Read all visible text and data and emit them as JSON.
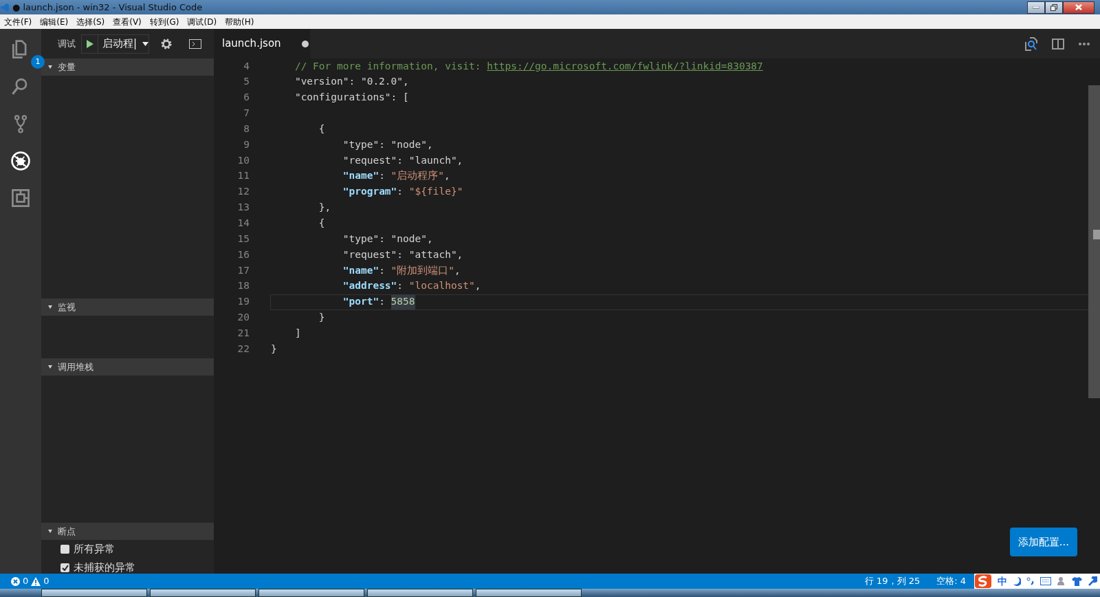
{
  "window": {
    "title": "● launch.json - win32 - Visual Studio Code"
  },
  "menu": [
    "文件(F)",
    "编辑(E)",
    "选择(S)",
    "查看(V)",
    "转到(G)",
    "调试(D)",
    "帮助(H)"
  ],
  "activity_bar": [
    {
      "kind": "files",
      "badge": "1",
      "selected": false
    },
    {
      "kind": "search",
      "selected": false
    },
    {
      "kind": "git",
      "selected": false
    },
    {
      "kind": "debug",
      "selected": true
    },
    {
      "kind": "extensions",
      "selected": false
    }
  ],
  "debug_toolbar": {
    "label": "调试",
    "configuration": "启动程|"
  },
  "tab": {
    "label": "launch.json",
    "dirty": true
  },
  "sidebar": {
    "sections": [
      {
        "title": "变量",
        "expanded": true
      },
      {
        "title": "监视",
        "expanded": true
      },
      {
        "title": "调用堆栈",
        "expanded": true
      },
      {
        "title": "断点",
        "expanded": true,
        "items": [
          {
            "label": "所有异常",
            "checked": false
          },
          {
            "label": "未捕获的异常",
            "checked": true
          }
        ]
      }
    ]
  },
  "editor": {
    "lines": [
      {
        "number": "4",
        "current": false,
        "kind": "i1",
        "tokens": [
          {
            "kind": "comment",
            "text": "// For more information, visit: "
          },
          {
            "kind": "link",
            "text": "https://go.microsoft.com/fwlink/?linkid=830387"
          }
        ]
      },
      {
        "number": "5",
        "current": false,
        "kind": "i1",
        "tokens": [
          {
            "kind": "plain",
            "text": "\"version\": \"0.2.0\","
          }
        ]
      },
      {
        "number": "6",
        "current": false,
        "kind": "i1",
        "tokens": [
          {
            "kind": "plain",
            "text": "\"configurations\": ["
          }
        ]
      },
      {
        "number": "7",
        "current": false,
        "kind": "i0"
      },
      {
        "number": "8",
        "current": false,
        "kind": "i2",
        "tokens": [
          {
            "kind": "plain",
            "text": "{"
          }
        ]
      },
      {
        "number": "9",
        "current": false,
        "kind": "i3",
        "tokens": [
          {
            "kind": "plain",
            "text": "\"type\": \"node\","
          }
        ]
      },
      {
        "number": "10",
        "current": false,
        "kind": "i3",
        "tokens": [
          {
            "kind": "plain",
            "text": "\"request\": \"launch\","
          }
        ]
      },
      {
        "number": "11",
        "current": false,
        "kind": "i3",
        "tokens": [
          {
            "kind": "key",
            "text": "\"name\""
          },
          {
            "kind": "plain",
            "text": ": "
          },
          {
            "kind": "string",
            "text": "\"启动程序\""
          },
          {
            "kind": "plain",
            "text": ","
          }
        ]
      },
      {
        "number": "12",
        "current": false,
        "kind": "i3",
        "tokens": [
          {
            "kind": "key",
            "text": "\"program\""
          },
          {
            "kind": "plain",
            "text": ": "
          },
          {
            "kind": "string",
            "text": "\"${file}\""
          }
        ]
      },
      {
        "number": "13",
        "current": false,
        "kind": "i2",
        "tokens": [
          {
            "kind": "plain",
            "text": "},"
          }
        ]
      },
      {
        "number": "14",
        "current": false,
        "kind": "i2",
        "tokens": [
          {
            "kind": "plain",
            "text": "{"
          }
        ]
      },
      {
        "number": "15",
        "current": false,
        "kind": "i3",
        "tokens": [
          {
            "kind": "plain",
            "text": "\"type\": \"node\","
          }
        ]
      },
      {
        "number": "16",
        "current": false,
        "kind": "i3",
        "tokens": [
          {
            "kind": "plain",
            "text": "\"request\": \"attach\","
          }
        ]
      },
      {
        "number": "17",
        "current": false,
        "kind": "i3",
        "tokens": [
          {
            "kind": "key",
            "text": "\"name\""
          },
          {
            "kind": "plain",
            "text": ": "
          },
          {
            "kind": "string",
            "text": "\"附加到端口\""
          },
          {
            "kind": "plain",
            "text": ","
          }
        ]
      },
      {
        "number": "18",
        "current": false,
        "kind": "i3",
        "tokens": [
          {
            "kind": "key",
            "text": "\"address\""
          },
          {
            "kind": "plain",
            "text": ": "
          },
          {
            "kind": "string",
            "text": "\"localhost\""
          },
          {
            "kind": "plain",
            "text": ","
          }
        ]
      },
      {
        "number": "19",
        "current": true,
        "kind": "i3",
        "tokens": [
          {
            "kind": "key",
            "text": "\"port\""
          },
          {
            "kind": "plain",
            "text": ": "
          },
          {
            "kind": "number",
            "text": "5858"
          }
        ]
      },
      {
        "number": "20",
        "current": false,
        "kind": "i2",
        "tokens": [
          {
            "kind": "plain",
            "text": "}"
          }
        ]
      },
      {
        "number": "21",
        "current": false,
        "kind": "i1",
        "tokens": [
          {
            "kind": "plain",
            "text": "]"
          }
        ]
      },
      {
        "number": "22",
        "current": false,
        "kind": "i0",
        "tokens": [
          {
            "kind": "plain",
            "text": "}"
          }
        ]
      }
    ]
  },
  "add_config_button": "添加配置...",
  "status_bar": {
    "errors": "0",
    "warnings": "0",
    "position": "行 19，列 25",
    "indent": "空格: 4",
    "ime": "中"
  }
}
